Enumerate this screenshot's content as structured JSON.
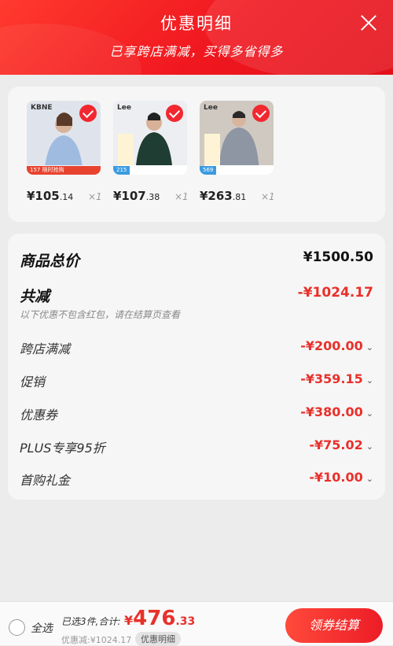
{
  "header": {
    "title": "优惠明细",
    "subtitle": "已享跨店满减，买得多省得多"
  },
  "products": [
    {
      "brand": "KBNE",
      "price_int": "¥105",
      "price_dec": ".14",
      "qty": "×1",
      "tag": "157 限时抢购",
      "tag_color": "#e8432f"
    },
    {
      "brand": "Lee",
      "price_int": "¥107",
      "price_dec": ".38",
      "qty": "×1",
      "tag": "215",
      "tag_color": "#3b9be0"
    },
    {
      "brand": "Lee",
      "price_int": "¥263",
      "price_dec": ".81",
      "qty": "×1",
      "tag": "569",
      "tag_color": "#3b9be0"
    }
  ],
  "summary": {
    "total_label": "商品总价",
    "total_value": "¥1500.50",
    "reduce_label": "共减",
    "reduce_value": "-¥1024.17",
    "note": "以下优惠不包含红包，请在结算页查看",
    "items": [
      {
        "label": "跨店满减",
        "value": "-¥200.00"
      },
      {
        "label": "促销",
        "value": "-¥359.15"
      },
      {
        "label": "优惠券",
        "value": "-¥380.00"
      },
      {
        "label": "PLUS专享95折",
        "value": "-¥75.02"
      },
      {
        "label": "首购礼金",
        "value": "-¥10.00"
      }
    ]
  },
  "footer": {
    "select_all": "全选",
    "selected_info": "已选3件,合计:",
    "total_cur": "¥",
    "total_int": "476",
    "total_dec": ".33",
    "saved": "优惠减:¥1024.17",
    "detail_badge": "优惠明细",
    "checkout": "领券结算"
  },
  "colors": {
    "accent": "#e9302b",
    "header": "#f0171f"
  }
}
